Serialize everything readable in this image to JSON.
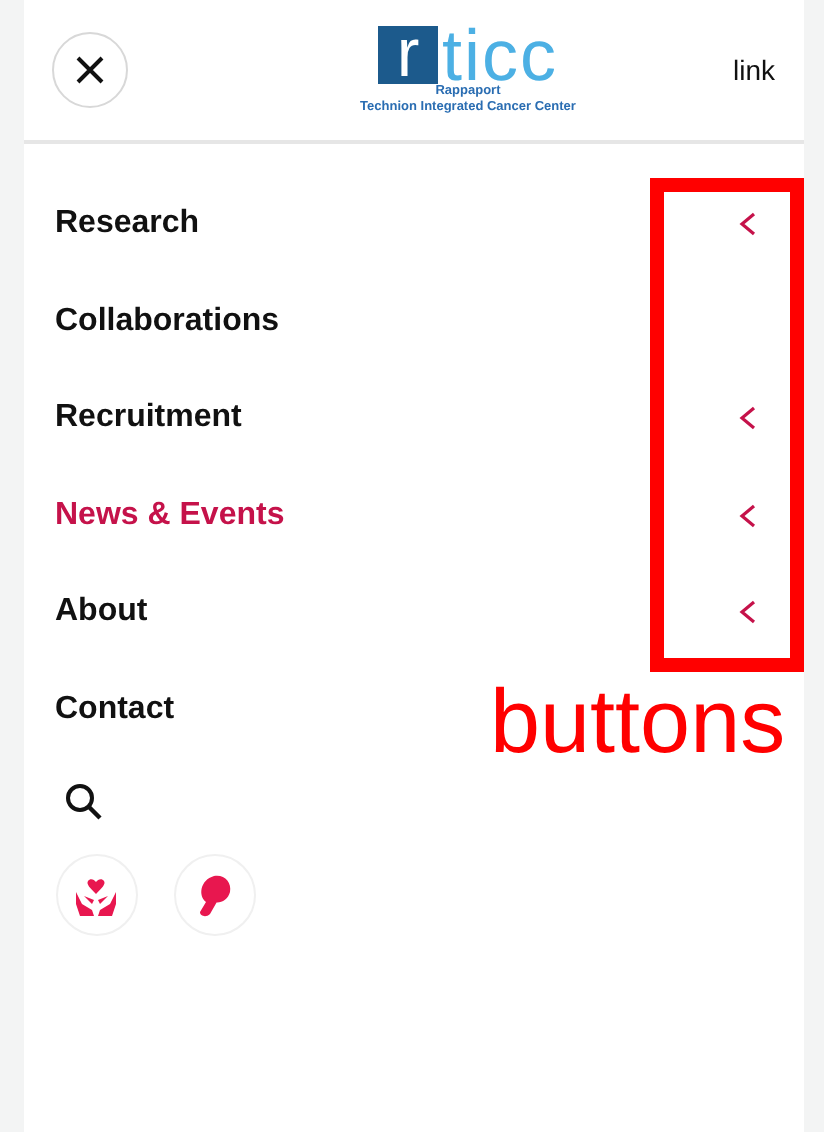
{
  "header": {
    "logo": {
      "mark_letter": "r",
      "mark_rest": "ticc",
      "line_1": "Rappaport",
      "line_2": "Technion Integrated Cancer Center"
    },
    "link": "link"
  },
  "menu": [
    {
      "label": "Research",
      "has_submenu": true,
      "selected": false
    },
    {
      "label": "Collaborations",
      "has_submenu": false,
      "selected": false
    },
    {
      "label": "Recruitment",
      "has_submenu": true,
      "selected": false
    },
    {
      "label": "News & Events",
      "has_submenu": true,
      "selected": true
    },
    {
      "label": "About",
      "has_submenu": true,
      "selected": false
    },
    {
      "label": "Contact",
      "has_submenu": false,
      "selected": false
    }
  ],
  "annotation": {
    "label": "buttons"
  }
}
